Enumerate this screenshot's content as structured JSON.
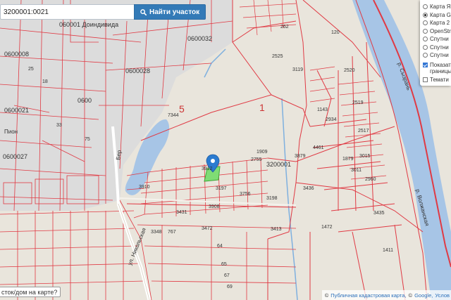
{
  "search": {
    "value": "3200001:0021",
    "button_label": "Найти участок"
  },
  "layers": {
    "options": [
      {
        "label": "Карта Я",
        "selected": false
      },
      {
        "label": "Карта G",
        "selected": true
      },
      {
        "label": "Карта 2",
        "selected": false
      },
      {
        "label": "OpenStr",
        "selected": false
      },
      {
        "label": "Спутни",
        "selected": false
      },
      {
        "label": "Спутни",
        "selected": false
      },
      {
        "label": "Спутни",
        "selected": false
      }
    ],
    "show_borders_line1": "Показат",
    "show_borders_line2": "границы",
    "thematic_label": "Темати"
  },
  "ask_label": "сток/дом на карте?",
  "attribution": {
    "symbol1": "©",
    "source1": "Публичная кадастровая карта,",
    "symbol2": "©",
    "source2": "Google,",
    "source3": "Услов"
  },
  "colors": {
    "parcel_line": "#e03a44",
    "river": "#a7c5e6",
    "built_area": "#dcdcdc",
    "open_land": "#e9e5dc",
    "highlight": "#7fdc74",
    "marker": "#2b7bd0"
  },
  "map_labels": {
    "quarters": [
      "0600032",
      "0600028",
      "0600008",
      "0600021",
      "0600027",
      "3200001"
    ],
    "quarter_partial": "0600",
    "zones": [
      "5",
      "1"
    ],
    "parcels": [
      "120",
      "3119",
      "2520",
      "2519",
      "2517",
      "2960",
      "1143",
      "2934",
      "1909",
      "2755",
      "7344",
      "4461",
      "3879",
      "3436",
      "3756",
      "3198",
      "3431",
      "3348",
      "767",
      "3472",
      "3435",
      "1472",
      "1411",
      "64",
      "65",
      "67",
      "69",
      "3413",
      "3910",
      "3908",
      "3197",
      "1879",
      "3011",
      "3015",
      "25",
      "18",
      "33",
      "75"
    ],
    "parcel_partial": [
      "2525",
      "262",
      "3912"
    ],
    "street": "ул. Никольская",
    "road_short": "Бер",
    "district_fragment": "Пион",
    "center_fragment": "060001 Доиндивида",
    "river_label": "р. Сызрань",
    "river_label2": "р. Волжанская"
  }
}
